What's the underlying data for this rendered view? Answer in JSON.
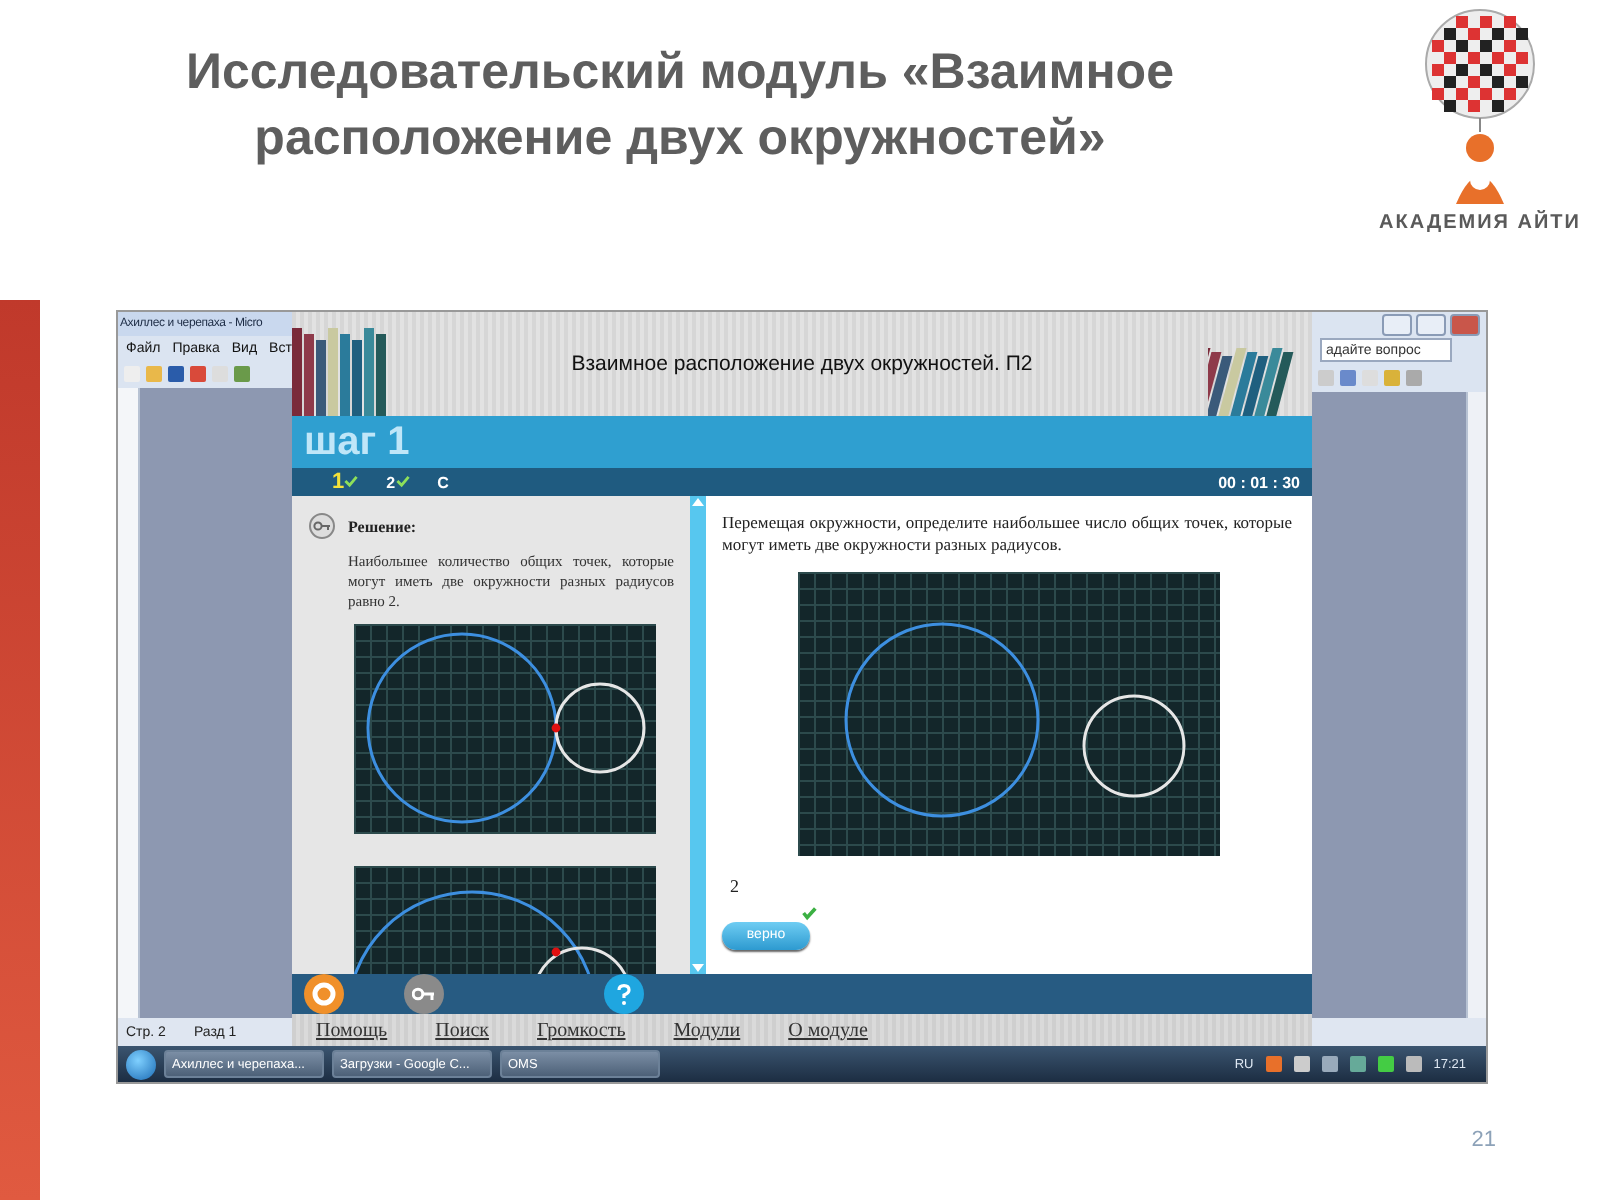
{
  "slide": {
    "title": "Исследовательский модуль «Взаимное расположение двух окружностей»",
    "logo_text": "АКАДЕМИЯ АЙТИ",
    "page_number": "21"
  },
  "word_window": {
    "title": "Ахиллес и черепаха - Micro",
    "menu": [
      "Файл",
      "Правка",
      "Вид",
      "Вст"
    ],
    "help_field": {
      "placeholder": "адайте вопрос"
    },
    "status": [
      "Стр. 2",
      "Разд 1"
    ]
  },
  "app": {
    "title": "Взаимное расположение двух окружностей. П2",
    "step_title": "шаг 1",
    "steps": [
      {
        "label": "1",
        "done": true,
        "selected": true
      },
      {
        "label": "2",
        "done": true,
        "selected": false
      },
      {
        "label": "C",
        "done": false,
        "selected": false
      }
    ],
    "timer": "00 : 01 : 30",
    "solution": {
      "heading": "Решение:",
      "text": "Наибольшее количество общих точек, которые могут иметь две окружности разных радиусов равно 2."
    },
    "task": {
      "text": "Перемещая окружности, определите наибольшее число общих точек, которые могут иметь две окружности разных радиусов.",
      "answer": "2",
      "button": "верно",
      "correct": true
    },
    "menu": [
      "Помощь",
      "Поиск",
      "Громкость",
      "Модули",
      "О модуле"
    ]
  },
  "taskbar": {
    "buttons": [
      "Ахиллес и черепаха...",
      "Загрузки - Google C...",
      "OMS"
    ],
    "language": "RU",
    "clock": "17:21"
  }
}
